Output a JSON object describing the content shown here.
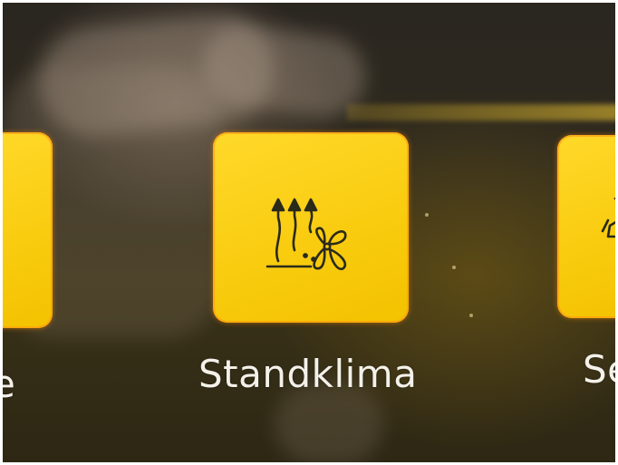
{
  "screen": {
    "tiles": [
      {
        "id": "left",
        "label_fragment": "e",
        "accent": "#f9cc10"
      },
      {
        "id": "standklima",
        "label": "Standklima",
        "icon": "parking-climate-icon",
        "accent": "#f9cc10"
      },
      {
        "id": "right",
        "label_fragment": "Se",
        "icon": "seat-icon",
        "accent": "#f9cc10"
      }
    ]
  },
  "colors": {
    "tile_yellow": "#f9cc10",
    "label_text": "#f4f1ea",
    "icon_stroke": "#2a2a1a"
  }
}
